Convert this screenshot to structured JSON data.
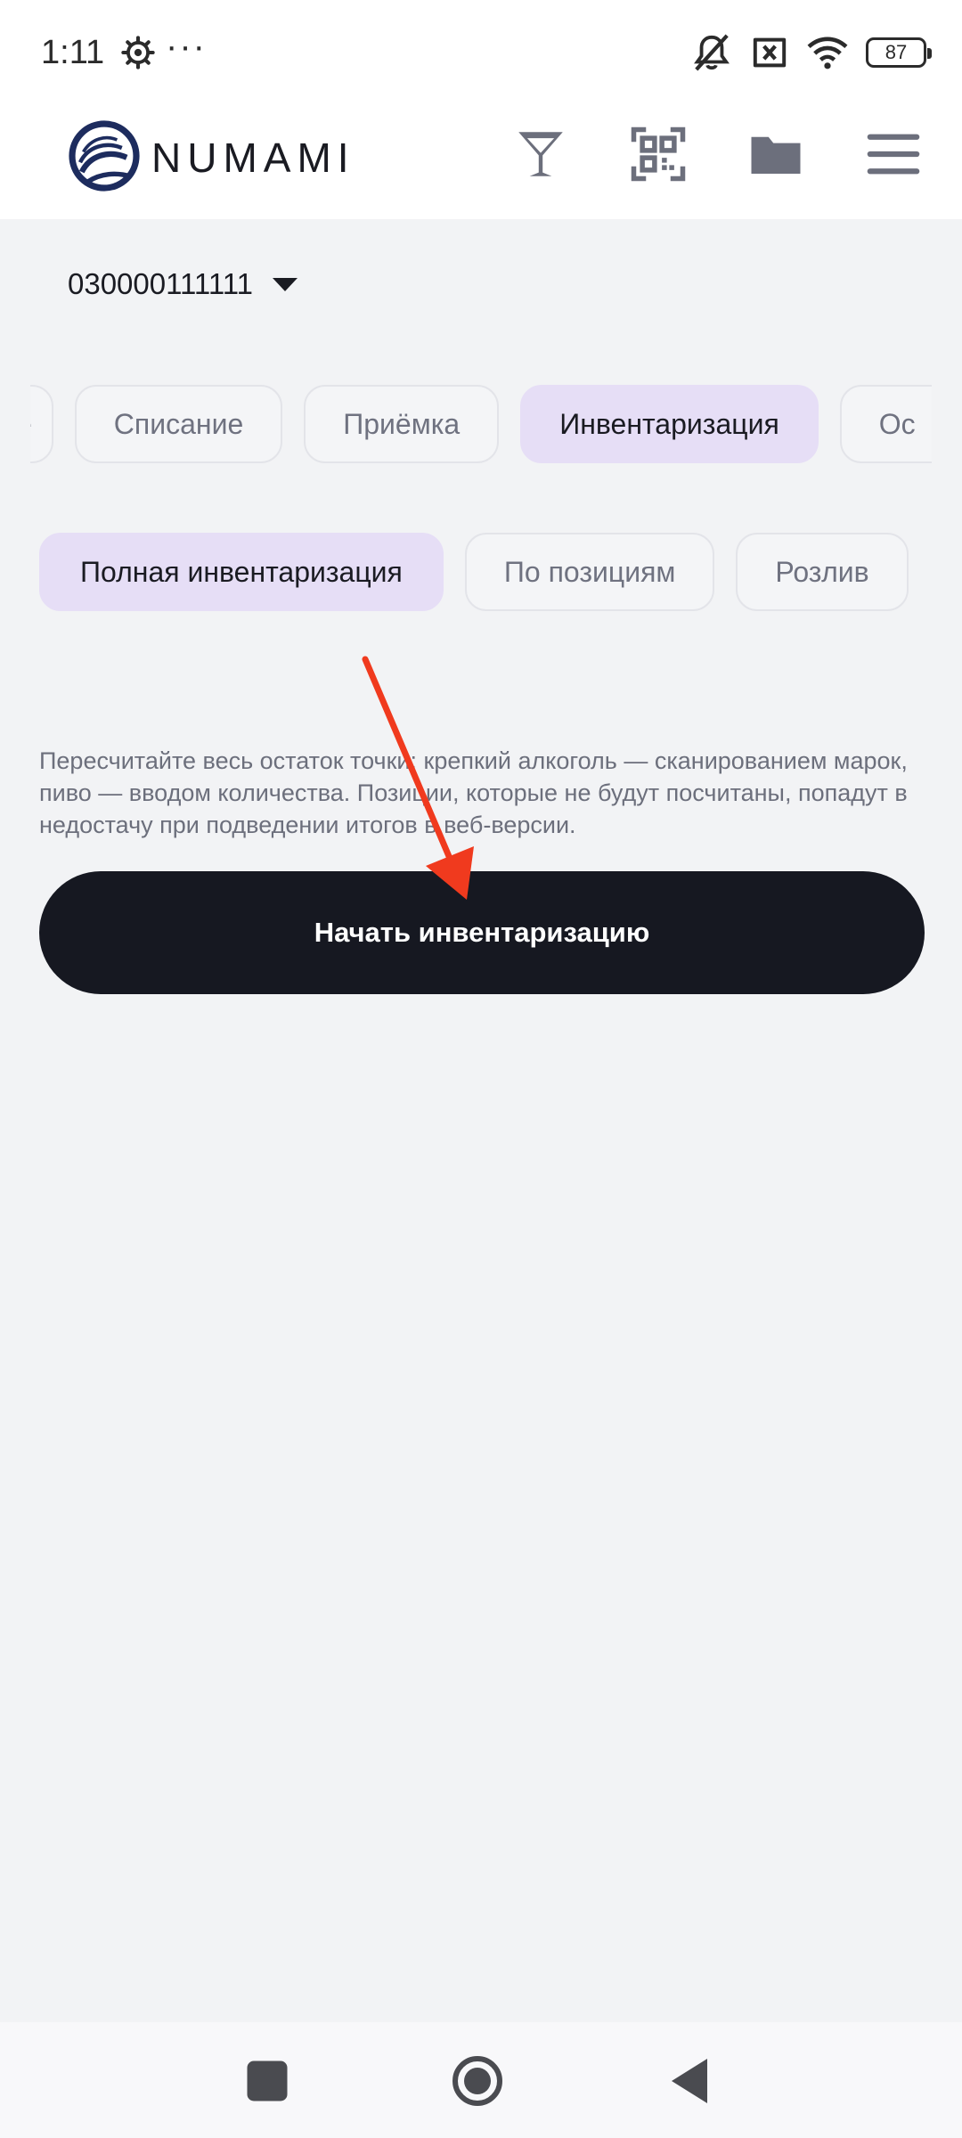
{
  "status_bar": {
    "time": "1:11",
    "more": "···",
    "battery": "87",
    "icons": [
      "settings-icon",
      "mute-icon",
      "sim-off-icon",
      "wifi-icon",
      "battery-icon"
    ]
  },
  "header": {
    "logo_text": "NUMAMI",
    "icons": [
      "glass-icon",
      "qr-code-icon",
      "folder-icon",
      "menu-icon"
    ]
  },
  "terminal": {
    "id": "030000111111"
  },
  "tabs": [
    {
      "label": "е"
    },
    {
      "label": "Списание"
    },
    {
      "label": "Приёмка"
    },
    {
      "label": "Инвентаризация"
    },
    {
      "label": "Ос"
    }
  ],
  "active_tab": "Инвентаризация",
  "subtabs": [
    {
      "label": "Полная инвентаризация"
    },
    {
      "label": "По позициям"
    },
    {
      "label": "Розлив"
    }
  ],
  "active_subtab": "Полная инвентаризация",
  "description": "Пересчитайте весь остаток точки: крепкий алкоголь — сканированием марок, пиво — вводом количества. Позиции, которые не будут посчитаны, попадут в недостачу при подведении итогов в веб-версии.",
  "start_button": "Начать инвентаризацию",
  "colors": {
    "accent": "#e6def6",
    "button": "#161821",
    "arrow": "#f03a1e",
    "background": "#f2f3f5"
  },
  "nav_icons": [
    "recents-icon",
    "home-icon",
    "back-icon"
  ]
}
